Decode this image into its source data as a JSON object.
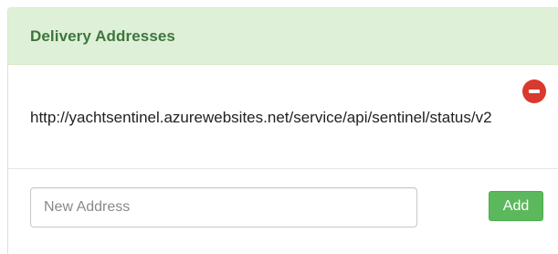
{
  "panel": {
    "title": "Delivery Addresses",
    "heading_bg": "#dff0d8",
    "heading_text_color": "#3c763d"
  },
  "addresses": [
    {
      "url": "http://yachtsentinel.azurewebsites.net/service/api/sentinel/status/v2",
      "remove_icon": "remove-circle-icon"
    }
  ],
  "new_address": {
    "placeholder": "New Address",
    "value": ""
  },
  "add_button": {
    "label": "Add",
    "color": "#5cb85c"
  },
  "remove_color": "#d9392e"
}
